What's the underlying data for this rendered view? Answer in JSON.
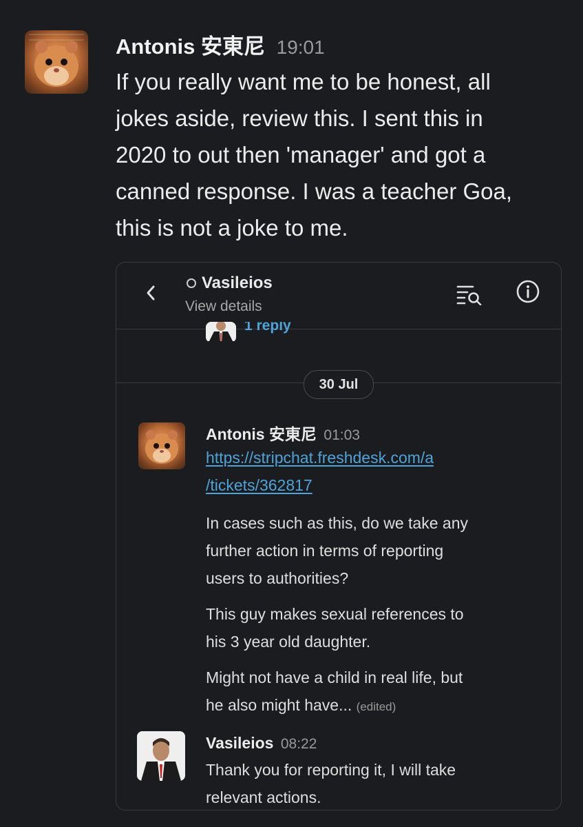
{
  "outer": {
    "author": "Antonis 安東尼",
    "time": "19:01",
    "body_lines": [
      "If you really want me to be honest, all",
      "jokes aside, review this.  I sent this in",
      "2020 to out then 'manager' and got a",
      "canned response.  I was a teacher Goa,",
      "this is not a joke to me."
    ]
  },
  "shot": {
    "channel_name": "Vasileios",
    "view_details": "View details",
    "partial_reply_text": "1 reply",
    "date_divider": "30 Jul",
    "message1": {
      "author": "Antonis 安東尼",
      "time": "01:03",
      "link_lines": [
        "https://stripchat.freshdesk.com/a",
        "/tickets/362817"
      ],
      "para1_lines": [
        "In cases such as this, do we take any",
        "further action in terms of reporting",
        "users to authorities?"
      ],
      "para2_lines": [
        "This guy makes sexual references to",
        "his 3 year old daughter."
      ],
      "para3_lines": [
        "Might not have a child in real life, but",
        "he also might have..."
      ],
      "edited": "(edited)"
    },
    "message2": {
      "author": "Vasileios",
      "time": "08:22",
      "lines": [
        "Thank you for reporting it, I will take",
        "relevant actions."
      ]
    }
  },
  "colors": {
    "background": "#1b1c1f",
    "link": "#4fa3d8",
    "muted": "#9a9a9a"
  },
  "icons": [
    "back-chevron-icon",
    "presence-icon",
    "search-list-icon",
    "info-icon"
  ]
}
